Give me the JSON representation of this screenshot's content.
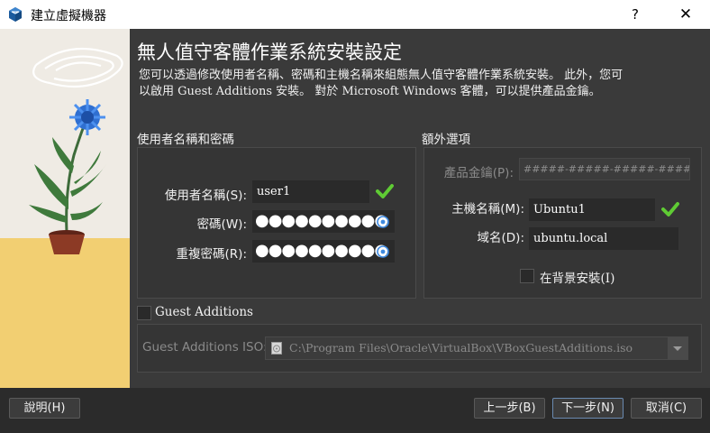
{
  "window": {
    "title": "建立虛擬機器",
    "help_glyph": "?",
    "close_glyph": "✕"
  },
  "page": {
    "heading": "無人值守客體作業系統安裝設定",
    "description": "您可以透過修改使用者名稱、密碼和主機名稱來組態無人值守客體作業系統安裝。 此外，您可以啟用 Guest Additions 安裝。 對於 Microsoft Windows 客體，可以提供產品金鑰。"
  },
  "credentials": {
    "section_label": "使用者名稱和密碼",
    "username_label": "使用者名稱(S):",
    "username_value": "user1",
    "password_label": "密碼(W):",
    "password_value": "●●●●●●●●●●",
    "repeat_label": "重複密碼(R):",
    "repeat_value": "●●●●●●●●●●"
  },
  "extra": {
    "section_label": "額外選項",
    "product_key_label": "產品金鑰(P):",
    "product_key_placeholder": "#####-#####-#####-#####-#####",
    "hostname_label": "主機名稱(M):",
    "hostname_value": "Ubuntu1",
    "domain_label": "域名(D):",
    "domain_value": "ubuntu.local",
    "background_install_label": "在背景安裝(I)"
  },
  "guest_additions": {
    "checkbox_label": "Guest Additions",
    "iso_label": "Guest Additions ISO:",
    "iso_path": "C:\\Program Files\\Oracle\\VirtualBox\\VBoxGuestAdditions.iso"
  },
  "footer": {
    "help_button": "說明(H)",
    "back_button": "上一步(B)",
    "next_button": "下一步(N)",
    "cancel_button": "取消(C)"
  },
  "colors": {
    "accent_check": "#5fcb34",
    "dialog_bg": "#3a3a3a",
    "titlebar_bg": "#ffffff"
  }
}
